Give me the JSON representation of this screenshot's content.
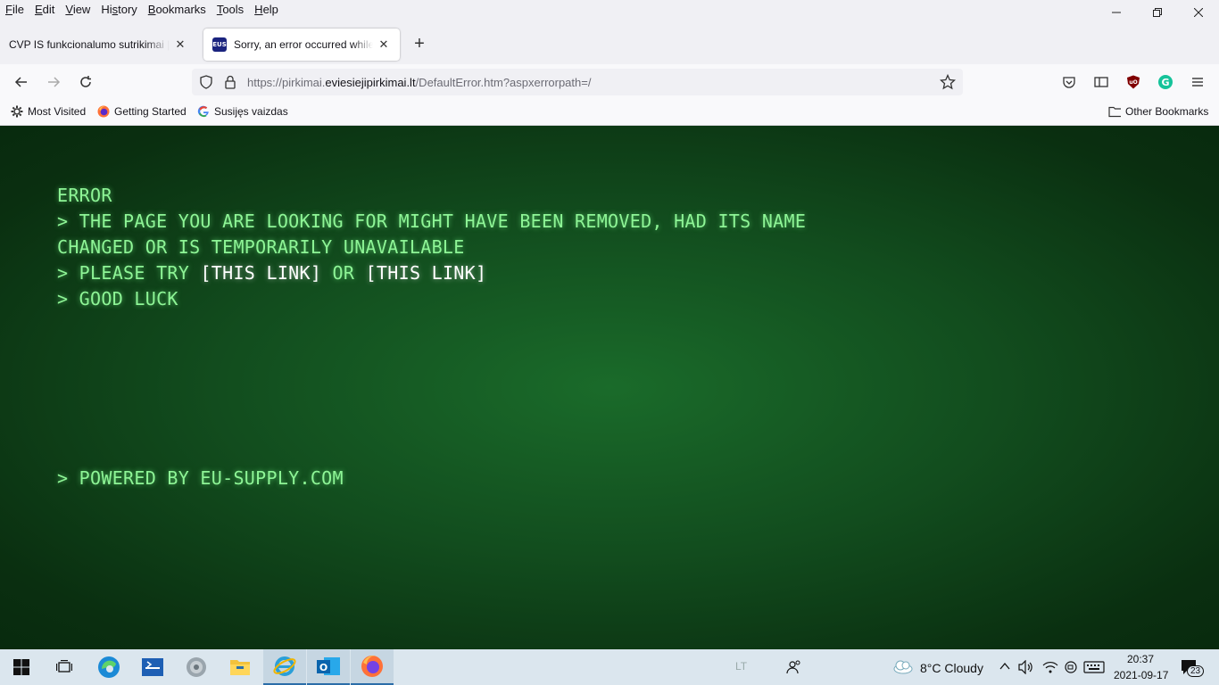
{
  "menubar": {
    "items": [
      {
        "u": "F",
        "rest": "ile"
      },
      {
        "u": "E",
        "rest": "dit"
      },
      {
        "u": "V",
        "rest": "iew"
      },
      {
        "pre": "Hi",
        "u": "s",
        "rest": "tory"
      },
      {
        "u": "B",
        "rest": "ookmarks"
      },
      {
        "u": "T",
        "rest": "ools"
      },
      {
        "u": "H",
        "rest": "elp"
      }
    ]
  },
  "tabs": [
    {
      "title": "CVP IS funkcionalumo sutrikimai | VPT",
      "active": false
    },
    {
      "title": "Sorry, an error occurred while processing",
      "active": true,
      "favicon": "EUS"
    }
  ],
  "url": {
    "prefix": "https://pirkimai.",
    "domain": "eviesiejipirkimai.lt",
    "path": "/DefaultError.htm?aspxerrorpath=/"
  },
  "bookmarks": [
    {
      "label": "Most Visited",
      "icon": "gear-icon"
    },
    {
      "label": "Getting Started",
      "icon": "firefox-icon"
    },
    {
      "label": "Susijęs vaizdas",
      "icon": "google-icon"
    }
  ],
  "other_bookmarks": "Other Bookmarks",
  "error_page": {
    "line1": "ERROR",
    "line2": "> THE PAGE YOU ARE LOOKING FOR MIGHT HAVE BEEN REMOVED, HAD ITS NAME",
    "line3": "CHANGED OR IS TEMPORARILY UNAVAILABLE",
    "line4_prefix": "> PLEASE TRY ",
    "link1": "[THIS LINK]",
    "line4_mid": " OR ",
    "link2": "[THIS LINK]",
    "line5": "> GOOD LUCK",
    "powered": "> POWERED BY EU-SUPPLY.COM"
  },
  "taskbar": {
    "weather": "8°C  Cloudy",
    "time": "20:37",
    "date": "2021-09-17",
    "notifications": "23",
    "lang": "LT"
  }
}
